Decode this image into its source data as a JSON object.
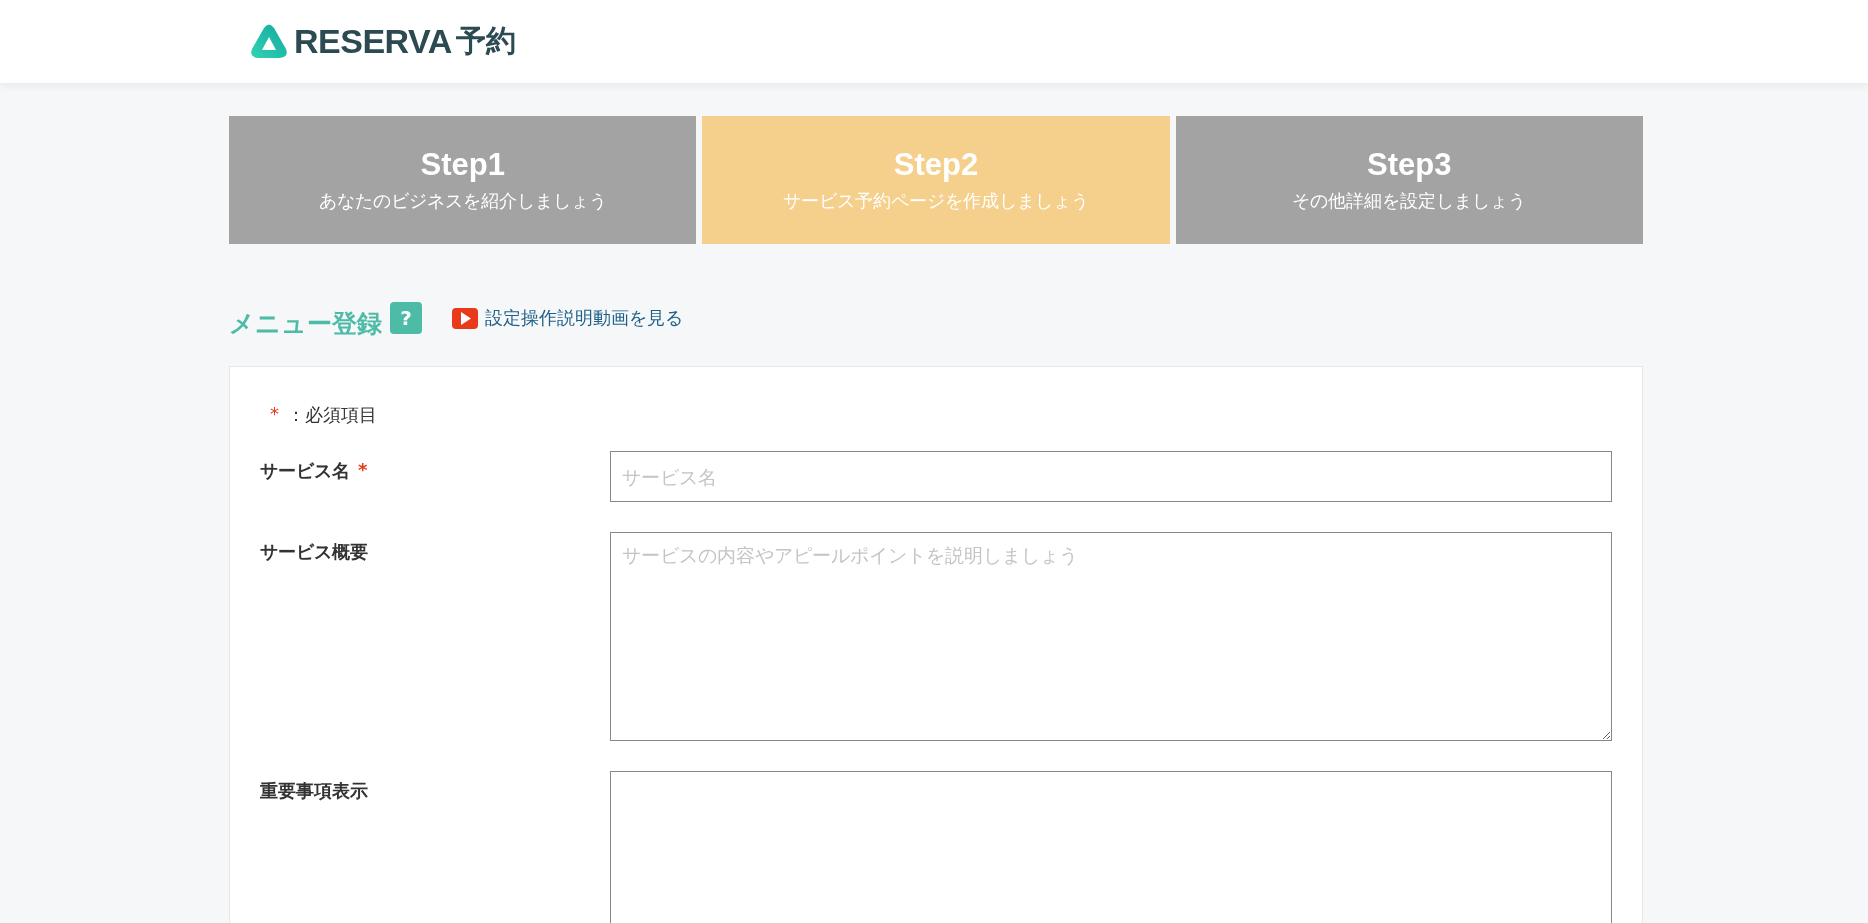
{
  "logo": {
    "wordmark": "RESERVA",
    "suffix": "予約"
  },
  "steps": [
    {
      "title": "Step1",
      "subtitle": "あなたのビジネスを紹介しましょう",
      "selected": false
    },
    {
      "title": "Step2",
      "subtitle": "サービス予約ページを作成しましょう",
      "selected": true
    },
    {
      "title": "Step3",
      "subtitle": "その他詳細を設定しましょう",
      "selected": false
    }
  ],
  "section": {
    "title": "メニュー登録",
    "help": "?",
    "video_link": "設定操作説明動画を見る"
  },
  "form": {
    "required_mark": "*",
    "required_note": "：必須項目",
    "fields": [
      {
        "label": "サービス名",
        "required": true,
        "kind": "input",
        "placeholder": "サービス名"
      },
      {
        "label": "サービス概要",
        "required": false,
        "kind": "textarea",
        "placeholder": "サービスの内容やアピールポイントを説明しましょう"
      },
      {
        "label": "重要事項表示",
        "required": false,
        "kind": "textarea-cut"
      }
    ]
  }
}
